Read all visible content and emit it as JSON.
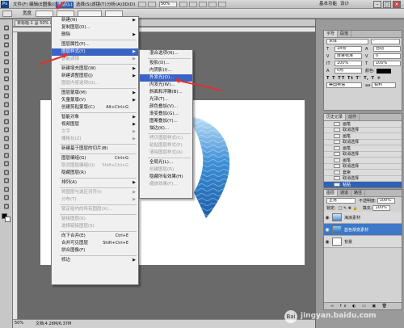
{
  "menubar": {
    "logo": "Ps",
    "items": [
      "文件(F)",
      "编辑(E)",
      "图像(I)",
      "图层(L)",
      "选择(S)",
      "滤镜(T)",
      "分析(A)",
      "3D(D)",
      "视图(V)",
      "窗口(W)",
      "帮助(H)"
    ],
    "active_index": 3,
    "zoom": "50%",
    "workspace": "基本功能",
    "design": "设计",
    "window_controls": [
      "minimize-icon",
      "restore-icon",
      "close-icon"
    ]
  },
  "options": {
    "width_label": "宽度"
  },
  "document": {
    "tab_title": "未标题-1 @ 50% (图层 1, RGB/8)",
    "zoom": "50%",
    "status_text": "文档:4.28M/6.37M"
  },
  "layer_menu": {
    "items": [
      {
        "label": "新建(N)",
        "arrow": true
      },
      {
        "label": "复制图层(D)..."
      },
      {
        "label": "删除",
        "arrow": true
      },
      {
        "sep": true
      },
      {
        "label": "图层属性(P)..."
      },
      {
        "label": "图层样式(Y)",
        "arrow": true,
        "highlight": true
      },
      {
        "label": "智能滤镜",
        "arrow": true,
        "disabled": true
      },
      {
        "sep": true
      },
      {
        "label": "新建填充图层(W)",
        "arrow": true
      },
      {
        "label": "新建调整图层(J)",
        "arrow": true
      },
      {
        "label": "图层内容选项(O)...",
        "disabled": true
      },
      {
        "sep": true
      },
      {
        "label": "图层蒙版(M)",
        "arrow": true
      },
      {
        "label": "矢量蒙版(V)",
        "arrow": true
      },
      {
        "label": "创建剪贴蒙版(C)",
        "shortcut": "Alt+Ctrl+G"
      },
      {
        "sep": true
      },
      {
        "label": "智能对象",
        "arrow": true
      },
      {
        "label": "视频图层",
        "arrow": true
      },
      {
        "label": "文字",
        "arrow": true,
        "disabled": true
      },
      {
        "label": "栅格化(Z)",
        "arrow": true,
        "disabled": true
      },
      {
        "sep": true
      },
      {
        "label": "新建基于图层的切片(B)"
      },
      {
        "sep": true
      },
      {
        "label": "图层编组(G)",
        "shortcut": "Ctrl+G"
      },
      {
        "label": "取消图层编组(U)",
        "shortcut": "Shift+Ctrl+G",
        "disabled": true
      },
      {
        "label": "隐藏图层(R)"
      },
      {
        "sep": true
      },
      {
        "label": "排列(A)",
        "arrow": true
      },
      {
        "sep": true
      },
      {
        "label": "将图层与选区对齐(I)",
        "arrow": true,
        "disabled": true
      },
      {
        "label": "分布(T)",
        "arrow": true,
        "disabled": true
      },
      {
        "sep": true
      },
      {
        "label": "锁定组内的所有图层(X)...",
        "disabled": true
      },
      {
        "sep": true
      },
      {
        "label": "链接图层(K)",
        "disabled": true
      },
      {
        "label": "选择链接图层(S)",
        "disabled": true
      },
      {
        "sep": true
      },
      {
        "label": "向下合并(E)",
        "shortcut": "Ctrl+E"
      },
      {
        "label": "合并可见图层",
        "shortcut": "Shift+Ctrl+E"
      },
      {
        "label": "拼合图像(F)"
      },
      {
        "sep": true
      },
      {
        "label": "修边",
        "arrow": true
      }
    ]
  },
  "style_submenu": {
    "items": [
      {
        "label": "混合选项(N)..."
      },
      {
        "sep": true
      },
      {
        "label": "投影(D)..."
      },
      {
        "label": "内阴影(I)..."
      },
      {
        "label": "外发光(O)...",
        "highlight": true
      },
      {
        "label": "内发光(W)..."
      },
      {
        "label": "斜面和浮雕(B)..."
      },
      {
        "label": "光泽(T)..."
      },
      {
        "label": "颜色叠加(V)..."
      },
      {
        "label": "渐变叠加(G)..."
      },
      {
        "label": "图案叠加(Y)..."
      },
      {
        "label": "描边(K)..."
      },
      {
        "sep": true
      },
      {
        "label": "拷贝图层样式(C)",
        "disabled": true
      },
      {
        "label": "粘贴图层样式(P)",
        "disabled": true
      },
      {
        "label": "清除图层样式(A)",
        "disabled": true
      },
      {
        "sep": true
      },
      {
        "label": "全局光(L)..."
      },
      {
        "label": "创建图层(R)",
        "disabled": true
      },
      {
        "label": "隐藏所有效果(H)"
      },
      {
        "label": "缩放效果(F)...",
        "disabled": true
      }
    ]
  },
  "character_panel": {
    "tabs": [
      "字符",
      "段落"
    ],
    "font_family": "宋体",
    "font_style": "-",
    "font_size": "18点",
    "leading": "自动",
    "kerning": "度量标准",
    "tracking": "0",
    "vscale": "100%",
    "hscale": "100%",
    "baseline": "0点",
    "color_label": "颜色:",
    "language": "美国英语",
    "antialias": "锐利"
  },
  "history_panel": {
    "tabs": [
      "历史记录",
      "动作"
    ],
    "items": [
      "画笔",
      "取消选择",
      "画笔",
      "取消选择",
      "画笔",
      "取消选择",
      "画笔",
      "取消选择",
      "套索",
      "取消选择",
      "粘贴"
    ],
    "selected_index": 10
  },
  "layers_panel": {
    "tabs": [
      "图层",
      "通道",
      "路径"
    ],
    "blend_mode": "正常",
    "opacity_label": "不透明度:",
    "opacity": "100%",
    "fill_label": "填充:",
    "fill": "100%",
    "lock_label": "锁定:",
    "layers": [
      {
        "name": "海浪素材",
        "selected": false
      },
      {
        "name": "蓝色渐变素材",
        "selected": true
      },
      {
        "name": "背景",
        "selected": false
      }
    ]
  },
  "watermark": "jingyan.baidu.com",
  "watermark_badge": "Bai",
  "colors": {
    "menu_highlight": "#3b63c4",
    "annotation": "#e03030",
    "canvas": "#ffffff",
    "workspace_bg": "#6a6a6a"
  }
}
